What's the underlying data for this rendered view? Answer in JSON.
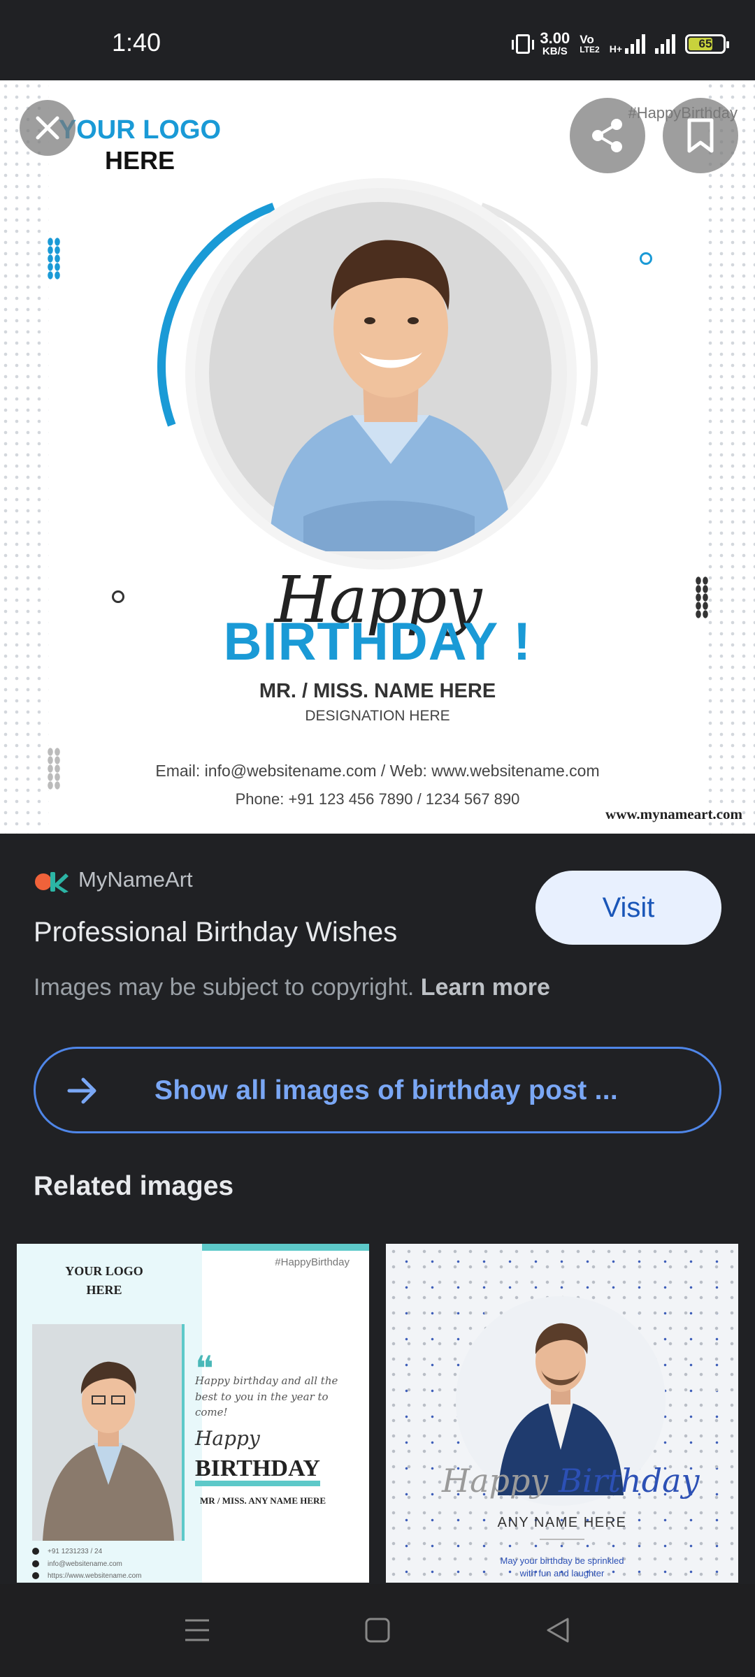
{
  "status_bar": {
    "time": "1:40",
    "net_speed_value": "3.00",
    "net_speed_unit": "KB/S",
    "volte_top": "Vo",
    "volte_bottom": "LTE2",
    "network_type": "H+",
    "battery_level": "65",
    "icons": [
      "vibrate-icon",
      "volte-icon",
      "signal-icon",
      "signal-icon-2",
      "battery-icon"
    ]
  },
  "hero_image": {
    "logo_line1": "YOUR LOGO",
    "logo_line2": "HERE",
    "hashtag": "#HappyBirthday",
    "happy": "Happy",
    "birthday": "BIRTHDAY !",
    "name": "MR. / MISS. NAME HERE",
    "designation": "DESIGNATION HERE",
    "contact_line1": "Email: info@websitename.com / Web: www.websitename.com",
    "contact_line2": "Phone: +91 123 456 7890 / 1234 567 890",
    "watermark": "www.mynameart.com",
    "accent_color": "#1a9ad6"
  },
  "overlay_buttons": {
    "close_icon": "close-icon",
    "share_icon": "share-icon",
    "bookmark_icon": "bookmark-icon"
  },
  "result": {
    "source_name": "MyNameArt",
    "title": "Professional Birthday Wishes",
    "visit_label": "Visit",
    "copyright_text": "Images may be subject to copyright.",
    "learn_more_label": "Learn more"
  },
  "show_all": {
    "label": "Show all images of birthday post ..."
  },
  "related": {
    "heading": "Related images",
    "items": [
      {
        "logo_line1": "YOUR LOGO",
        "logo_line2": "HERE",
        "hashtag": "#HappyBirthday",
        "quote_mark": "❝",
        "wish_text": "Happy birthday and all the best to you in the year to come!",
        "happy": "Happy",
        "birthday": "BIRTHDAY",
        "name": "MR / MISS. ANY NAME HERE",
        "phone": "+91 1231233 / 24",
        "email": "info@websitename.com",
        "web": "https://www.websitename.com"
      },
      {
        "happy": "Happy",
        "birthday": "Birthday",
        "name": "ANY NAME HERE",
        "wish_text1": "May your birthday be sprinkled",
        "wish_text2": "with fun and laughter"
      }
    ]
  },
  "navigation": {
    "menu_icon": "menu-icon",
    "home_icon": "home-icon",
    "back_icon": "back-icon"
  }
}
